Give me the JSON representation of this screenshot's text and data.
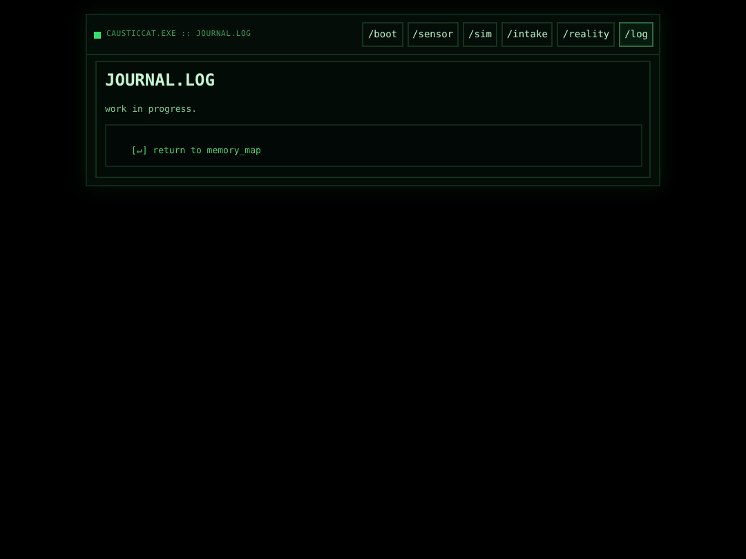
{
  "header": {
    "title": "CAUSTICCAT.EXE :: JOURNAL.LOG"
  },
  "nav": [
    {
      "label": "/boot",
      "selected": false
    },
    {
      "label": "/sensor",
      "selected": false
    },
    {
      "label": "/sim",
      "selected": false
    },
    {
      "label": "/intake",
      "selected": false
    },
    {
      "label": "/reality",
      "selected": false
    },
    {
      "label": "/log",
      "selected": true
    }
  ],
  "panel": {
    "heading": "JOURNAL.LOG",
    "text": "work in progress.",
    "link": "[↵] return to memory_map"
  }
}
